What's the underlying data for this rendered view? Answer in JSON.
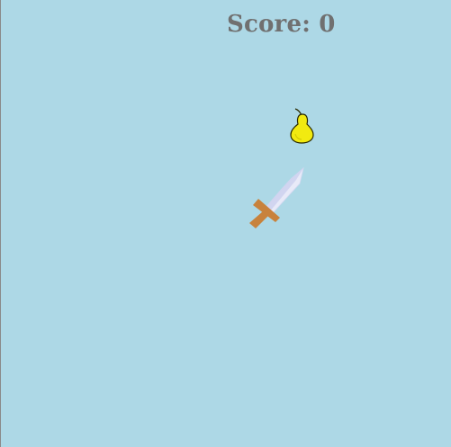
{
  "game": {
    "score_label": "Score:",
    "score_value": "0"
  },
  "colors": {
    "background": "#ADD8E6",
    "score_text": "#707070",
    "pear_body": "#F2EA10",
    "pear_outline": "#2A2A00",
    "sword_blade": "#E8EAF8",
    "sword_blade_shade": "#C8CCEC",
    "sword_hilt": "#C8823C"
  },
  "objects": [
    {
      "name": "pear",
      "icon": "pear-icon"
    },
    {
      "name": "sword",
      "icon": "sword-icon"
    }
  ]
}
